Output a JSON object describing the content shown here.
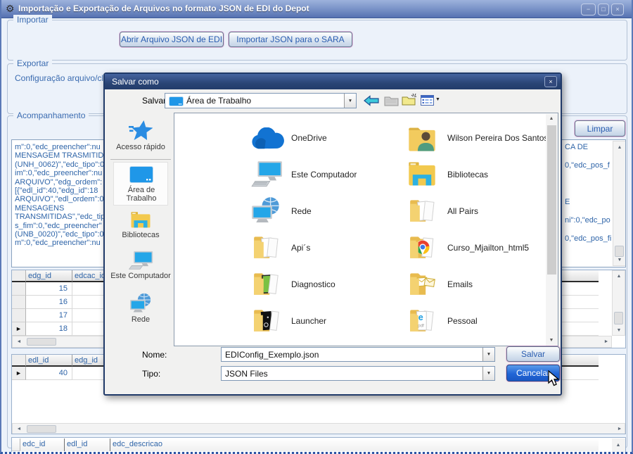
{
  "glyphs": {
    "min": "−",
    "max": "□",
    "close": "×",
    "down": "▼",
    "up": "▲",
    "left": "◄",
    "right": "►",
    "marker": "►",
    "gear": "⚙"
  },
  "window": {
    "title": "Importação e Exportação de Arquivos no formato JSON de EDI do Depot"
  },
  "importar": {
    "label": "Importar",
    "abrir_button": "Abrir Arquivo JSON de EDI",
    "importar_button": "Importar JSON para o SARA"
  },
  "exportar": {
    "label": "Exportar",
    "config_text": "Configuração arquivo/clie"
  },
  "acompanhamento": {
    "label": "Acompanhamento",
    "limpar_button": "Limpar",
    "log_left": "m\":0,\"edc_preencher\":nu\nMENSAGEM TRASMITIDA\n(UNH_0062)\",\"edc_tipo\":0\nim\":0,\"edc_preencher\":nu\nARQUIVO\",\"edg_ordem\":\n[{\"edl_id\":40,\"edg_id\":18\nARQUIVO\",\"edl_ordem\":0\nMENSAGENS\nTRANSMITIDAS\",\"edc_tip\ns_fim\":0,\"edc_preencher\"\n(UNB_0020)\",\"edc_tipo\":0\nm\":0,\"edc_preencher\":nu",
    "log_right": "CA DE\n\n0,\"edc_pos_f\n\n\n\nE\n\nni\":0,\"edc_po\n\n0,\"edc_pos_fi"
  },
  "grid1": {
    "columns": [
      "edg_id",
      "edcac_id"
    ],
    "rows": [
      "15",
      "16",
      "17",
      "18"
    ]
  },
  "grid2": {
    "columns": [
      "edl_id",
      "edg_id"
    ],
    "rows": [
      "40"
    ]
  },
  "grid3": {
    "columns": [
      "edc_id",
      "edl_id",
      "edc_descricao"
    ]
  },
  "dialog": {
    "title": "Salvar como",
    "save_in_label": "Salvar em:",
    "location": "Área de Trabalho",
    "sidebar": [
      "Acesso rápido",
      "Área de Trabalho",
      "Bibliotecas",
      "Este Computador",
      "Rede"
    ],
    "files_col1": [
      "OneDrive",
      "Este Computador",
      "Rede",
      "Api´s",
      "Diagnostico",
      "Launcher"
    ],
    "files_col2": [
      "Wilson Pereira Dos Santos",
      "Bibliotecas",
      "All Pairs",
      "Curso_Mjailton_html5",
      "Emails",
      "Pessoal"
    ],
    "name_label": "Nome:",
    "name_value": "EDIConfig_Exemplo.json",
    "type_label": "Tipo:",
    "type_value": "JSON Files",
    "save_button": "Salvar",
    "cancel_button": "Cancelar"
  }
}
